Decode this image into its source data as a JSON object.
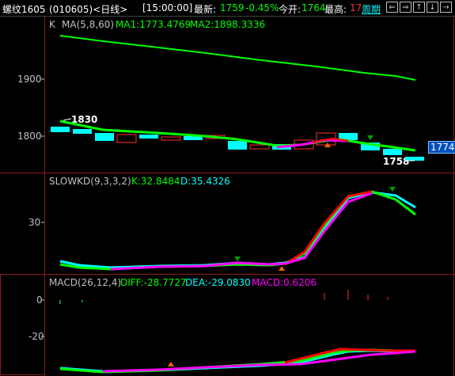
{
  "header": {
    "symbol": "螺纹1605",
    "code_period": "(010605)<日线>",
    "time": "[15:00:00]",
    "latest_label": "最新:",
    "latest_value": "1759",
    "change_pct": "-0.45%",
    "open_label": "今开:",
    "open_value": "1764",
    "high_label": "最高:",
    "high_value": "17",
    "period_link": "周期",
    "nav_buttons": [
      "⇐",
      "⇒",
      "↑",
      "↓",
      "→"
    ]
  },
  "price_pane": {
    "k_label": "K",
    "ma_label": "MA(5,8,60)",
    "ma1": "MA1:1773.4769",
    "ma2": "MA2:1898.3336",
    "y_ticks": [
      "1900",
      "1800"
    ],
    "high_marker": "1830",
    "low_marker": "1758",
    "last_price_box": "1774"
  },
  "kd_pane": {
    "title": "SLOWKD(9,3,3,2)",
    "k": "K:32.8484",
    "d": "D:35.4326",
    "y_ticks": [
      "30"
    ]
  },
  "macd_pane": {
    "title": "MACD(26,12,4)",
    "diff": "DIFF:-28.7727",
    "dea": "DEA:-29.0830",
    "macd": "MACD:0.6206",
    "y_ticks": [
      "0",
      "-20"
    ]
  },
  "colors": {
    "up": "#ff3030",
    "down": "#00ffff",
    "ma_green": "#00ff00",
    "kd_k": "#ff0000",
    "kd_d": "#ff00ff",
    "grid_red": "#8b1a1a"
  }
}
